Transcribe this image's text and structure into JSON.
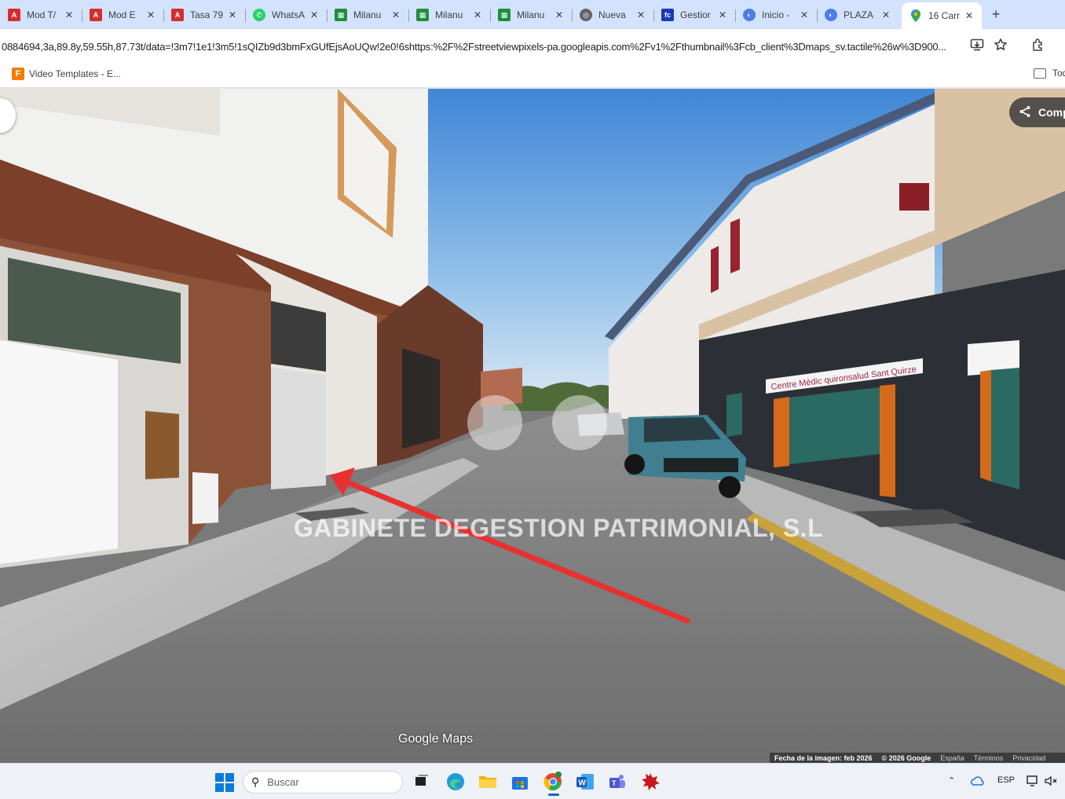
{
  "tabs": [
    {
      "title": "Mod T/",
      "icon": "pdf-icon"
    },
    {
      "title": "Mod E",
      "icon": "pdf-icon"
    },
    {
      "title": "Tasa 79",
      "icon": "pdf-icon"
    },
    {
      "title": "WhatsA",
      "icon": "whatsapp-icon"
    },
    {
      "title": "Milanu",
      "icon": "sheets-icon"
    },
    {
      "title": "Milanu",
      "icon": "sheets-icon"
    },
    {
      "title": "Milanu",
      "icon": "sheets-icon"
    },
    {
      "title": "Nueva",
      "icon": "chrome-icon"
    },
    {
      "title": "Gestior",
      "icon": "fc-icon"
    },
    {
      "title": "Inicio -",
      "icon": "globe-icon"
    },
    {
      "title": "PLAZA",
      "icon": "globe-icon"
    },
    {
      "title": "16 Carr",
      "icon": "maps-pin-icon",
      "active": true
    }
  ],
  "fav_letters": {
    "fc": "fc"
  },
  "address_bar": {
    "url": "0884694,3a,89.8y,59.55h,87.73t/data=!3m7!1e1!3m5!1sQIZb9d3bmFxGUfEjsAoUQw!2e0!6shttps:%2F%2Fstreetviewpixels-pa.googleapis.com%2Fv1%2Fthumbnail%3Fcb_client%3Dmaps_sv.tactile%26w%3D900..."
  },
  "bookmarks": {
    "left_item": "Video Templates - E...",
    "left_icon_letter": "F",
    "right_item": "Tod"
  },
  "street_view": {
    "watermark": "GABINETE DEGESTION PATRIMONIAL, S.L",
    "maps_logo": "Google Maps",
    "share_label": "Comp",
    "storefront_sign": "Centre Mèdic quironsalud Sant Quirze",
    "attribution": {
      "date": "Fecha de la imagen: feb 2026",
      "copyright": "© 2026 Google",
      "country": "España",
      "terms": "Términos",
      "privacy": "Privacidad"
    }
  },
  "taskbar": {
    "search_placeholder": "Buscar",
    "language": "ESP"
  },
  "colors": {
    "tabstrip": "#d3e3fd",
    "arrow": "#e8312f",
    "taskbar": "#eef1f6"
  }
}
